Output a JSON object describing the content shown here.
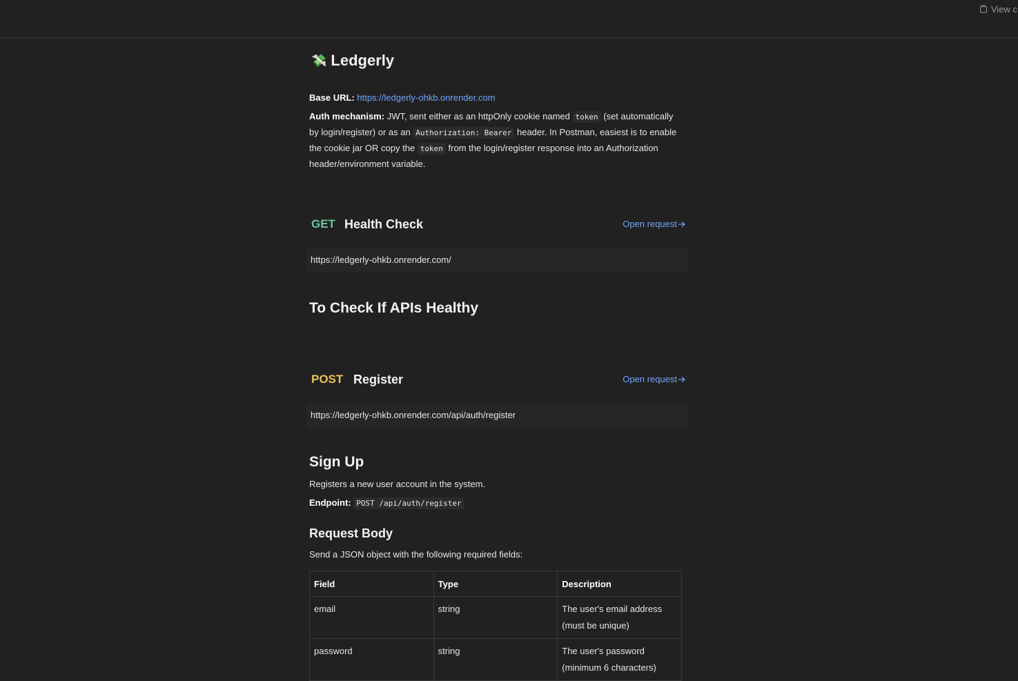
{
  "topbar": {
    "view_label": "View c"
  },
  "doc": {
    "emoji": "💸",
    "title": "Ledgerly",
    "base_url_label": "Base URL:",
    "base_url": "https://ledgerly-ohkb.onrender.com",
    "auth_label": "Auth mechanism:",
    "auth_text_1": " JWT, sent either as an httpOnly cookie named ",
    "auth_code_1": "token",
    "auth_text_2": " (set automatically by login/register) or as an ",
    "auth_code_2": "Authorization: Bearer",
    "auth_text_3": " header. In Postman, easiest is to enable the cookie jar OR copy the ",
    "auth_code_3": "token",
    "auth_text_4": " from the login/register response into an Authorization header/environment variable."
  },
  "requests": [
    {
      "method": "GET",
      "name": "Health Check",
      "open_label": "Open request",
      "url": "https://ledgerly-ohkb.onrender.com/",
      "heading": "To Check If APIs Healthy"
    },
    {
      "method": "POST",
      "name": "Register",
      "open_label": "Open request",
      "url": "https://ledgerly-ohkb.onrender.com/api/auth/register",
      "heading": "Sign Up",
      "description": "Registers a new user account in the system.",
      "endpoint_label": "Endpoint:",
      "endpoint_code": "POST /api/auth/register",
      "body_heading": "Request Body",
      "body_text": "Send a JSON object with the following required fields:",
      "table": {
        "headers": [
          "Field",
          "Type",
          "Description"
        ],
        "rows": [
          [
            "email",
            "string",
            "The user's email address (must be unique)"
          ],
          [
            "password",
            "string",
            "The user's password (minimum 6 characters)"
          ]
        ]
      }
    }
  ],
  "colors": {
    "background": "#212121",
    "get": "#6cc79c",
    "post": "#ebc35a",
    "link": "#6ea6ff"
  }
}
